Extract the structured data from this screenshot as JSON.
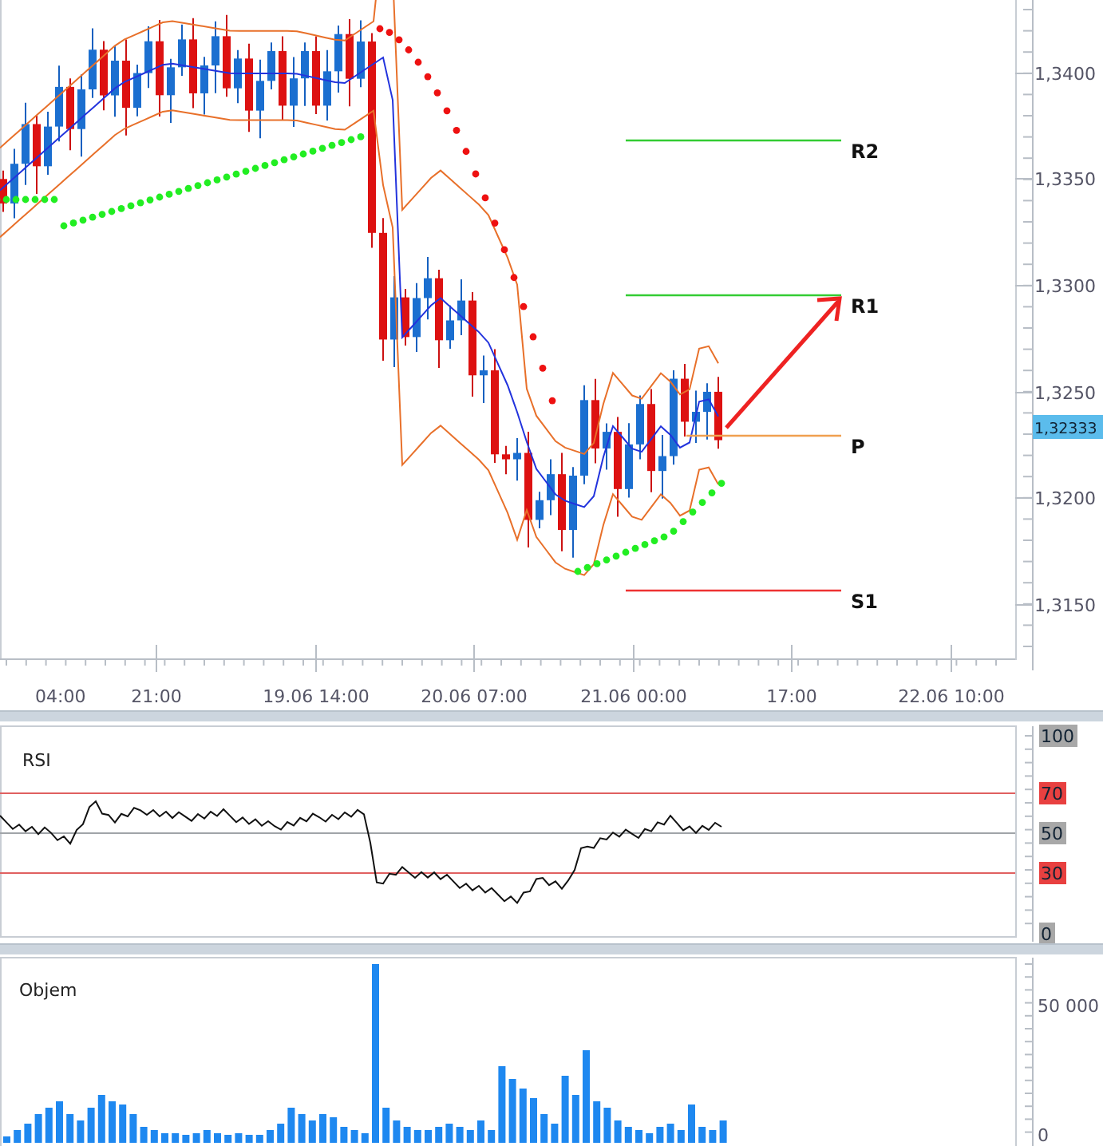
{
  "price_panel": {
    "y_axis_labels": [
      "1,3400",
      "1,3350",
      "1,3300",
      "1,3250",
      "1,3200",
      "1,3150"
    ],
    "current_price": "1,32333",
    "pivot_levels": [
      {
        "label": "R2",
        "color": "#33cc33"
      },
      {
        "label": "R1",
        "color": "#33cc33"
      },
      {
        "label": "P",
        "color": "#f0a050"
      },
      {
        "label": "S1",
        "color": "#ee3333"
      }
    ],
    "x_axis_labels": [
      "04:00",
      "21:00",
      "19.06 14:00",
      "20.06 07:00",
      "21.06 00:00",
      "17:00",
      "22.06 10:00"
    ]
  },
  "rsi_panel": {
    "title": "RSI",
    "y_axis_labels": [
      {
        "label": "100",
        "kind": "plain"
      },
      {
        "label": "70",
        "kind": "bound"
      },
      {
        "label": "50",
        "kind": "plain"
      },
      {
        "label": "30",
        "kind": "bound"
      },
      {
        "label": "0",
        "kind": "plain"
      }
    ]
  },
  "volume_panel": {
    "title": "Objem",
    "y_axis_labels": [
      "50 000",
      "0"
    ]
  }
}
